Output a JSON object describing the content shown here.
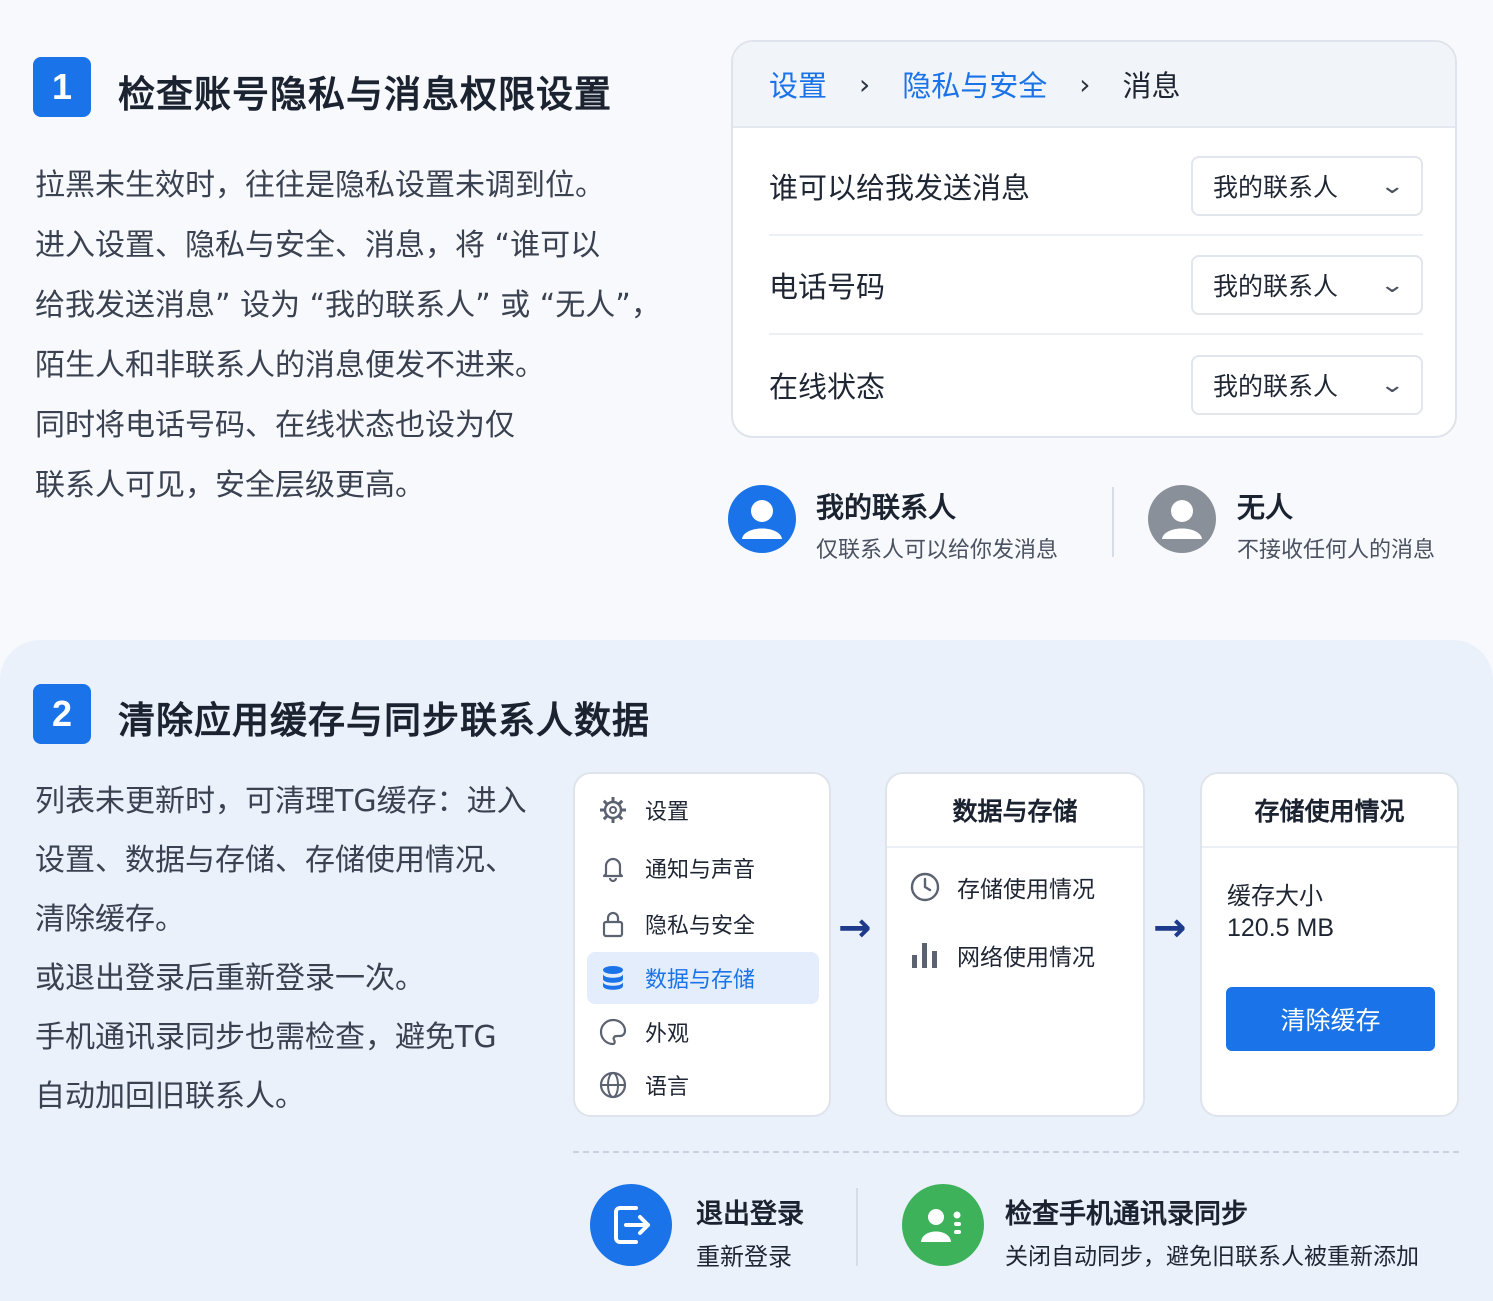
{
  "section1": {
    "step_number": "1",
    "title": "检查账号隐私与消息权限设置",
    "paragraph_lines": [
      "拉黑未生效时，往往是隐私设置未调到位。",
      "进入设置、隐私与安全、消息，将 “谁可以",
      "给我发送消息” 设为 “我的联系人” 或 “无人”，",
      "陌生人和非联系人的消息便发不进来。",
      "同时将电话号码、在线状态也设为仅",
      "联系人可见，安全层级更高。"
    ],
    "breadcrumb": {
      "items": [
        "设置",
        "隐私与安全",
        "消息"
      ],
      "separator": "›"
    },
    "settings_rows": [
      {
        "label": "谁可以给我发送消息",
        "value": "我的联系人"
      },
      {
        "label": "电话号码",
        "value": "我的联系人"
      },
      {
        "label": "在线状态",
        "value": "我的联系人"
      }
    ],
    "options": [
      {
        "title": "我的联系人",
        "subtitle": "仅联系人可以给你发消息",
        "avatar_color": "#1a73e8",
        "icon": "user-icon"
      },
      {
        "title": "无人",
        "subtitle": "不接收任何人的消息",
        "avatar_color": "#8a909a",
        "icon": "user-icon"
      }
    ]
  },
  "section2": {
    "step_number": "2",
    "title": "清除应用缓存与同步联系人数据",
    "paragraph_lines": [
      "列表未更新时，可清理TG缓存：进入",
      "设置、数据与存储、存储使用情况、",
      "清除缓存。",
      "或退出登录后重新登录一次。",
      "手机通讯录同步也需检查，避免TG",
      "自动加回旧联系人。"
    ],
    "menu": {
      "items": [
        {
          "label": "设置",
          "icon": "gear-icon",
          "active": false
        },
        {
          "label": "通知与声音",
          "icon": "bell-icon",
          "active": false
        },
        {
          "label": "隐私与安全",
          "icon": "lock-icon",
          "active": false
        },
        {
          "label": "数据与存储",
          "icon": "database-icon",
          "active": true
        },
        {
          "label": "外观",
          "icon": "palette-icon",
          "active": false
        },
        {
          "label": "语言",
          "icon": "globe-icon",
          "active": false
        }
      ]
    },
    "data_storage_card": {
      "title": "数据与存储",
      "items": [
        {
          "label": "存储使用情况",
          "icon": "clock-icon"
        },
        {
          "label": "网络使用情况",
          "icon": "bar-chart-icon"
        }
      ]
    },
    "storage_usage_card": {
      "title": "存储使用情况",
      "cache_label": "缓存大小",
      "cache_value": "120.5 MB",
      "clear_button": "清除缓存"
    },
    "bottom_actions": [
      {
        "title": "退出登录",
        "subtitle": "重新登录",
        "icon": "logout-icon",
        "color": "#1a73e8"
      },
      {
        "title": "检查手机通讯录同步",
        "subtitle": "关闭自动同步，避免旧联系人被重新添加",
        "icon": "contacts-icon",
        "color": "#3db25a"
      }
    ]
  },
  "colors": {
    "accent": "#1a73e8",
    "gray_avatar": "#8a909a",
    "green": "#3db25a",
    "arrow": "#1e3a8a"
  }
}
